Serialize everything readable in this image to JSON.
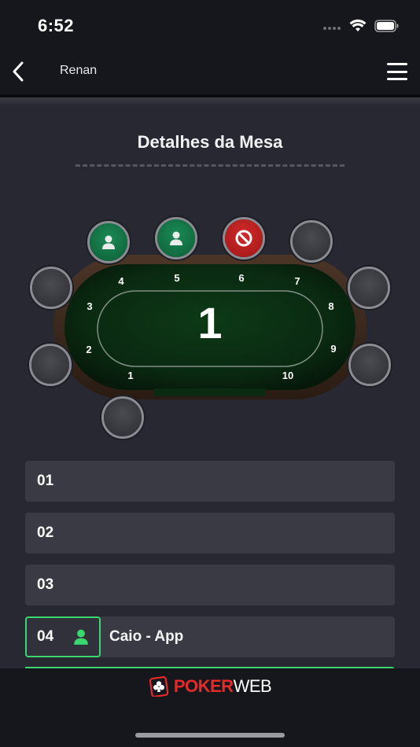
{
  "status_bar": {
    "time": "6:52"
  },
  "nav": {
    "title": "Renan"
  },
  "page": {
    "title": "Detalhes da Mesa"
  },
  "table": {
    "number": "1",
    "seat_numbers": [
      "1",
      "2",
      "3",
      "4",
      "5",
      "6",
      "7",
      "8",
      "9",
      "10"
    ]
  },
  "seat_list": [
    {
      "label": "01"
    },
    {
      "label": "02"
    },
    {
      "label": "03"
    },
    {
      "label": "04",
      "player": "Caio - App"
    }
  ],
  "footer": {
    "brand_part_a": "POKER",
    "brand_part_b": "WEB"
  },
  "colors": {
    "background": "#272831",
    "bar": "#16171c",
    "felt": "#0f3a1a",
    "seat_taken": "#1b8a55",
    "seat_blocked": "#d32b2b",
    "occupied_outline": "#3ad66e",
    "brand_red": "#e52a2a"
  }
}
